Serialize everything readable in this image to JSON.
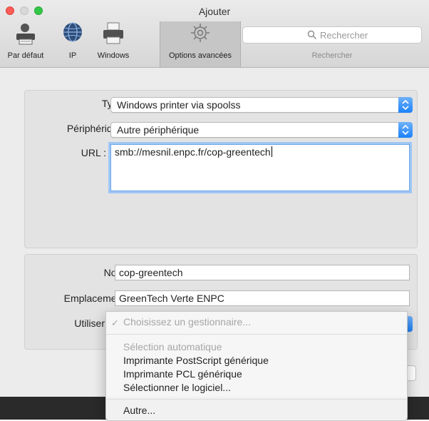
{
  "window": {
    "title": "Ajouter"
  },
  "toolbar": {
    "items": [
      {
        "label": "Par défaut",
        "icon": "default-printer-icon"
      },
      {
        "label": "IP",
        "icon": "globe-icon"
      },
      {
        "label": "Windows",
        "icon": "printer-icon"
      },
      {
        "label": "Options avancées",
        "icon": "gear-icon"
      }
    ],
    "search": {
      "placeholder": "Rechercher",
      "label": "Rechercher"
    }
  },
  "form": {
    "type": {
      "label": "Type :",
      "value": "Windows printer via spoolss"
    },
    "device": {
      "label": "Périphérique :",
      "value": "Autre périphérique"
    },
    "url": {
      "label": "URL :",
      "value": "smb://mesnil.enpc.fr/cop-greentech"
    },
    "name": {
      "label": "Nom :",
      "value": "cop-greentech"
    },
    "location": {
      "label": "Emplacement :",
      "value": "GreenTech Verte ENPC"
    },
    "use": {
      "label": "Utiliser",
      "value": "Choisissez un gestionnaire..."
    }
  },
  "menu": {
    "checked_item": "Choisissez un gestionnaire...",
    "disabled_item": "Sélection automatique",
    "items": [
      "Imprimante PostScript générique",
      "Imprimante PCL générique",
      "Sélectionner le logiciel..."
    ],
    "other": "Autre..."
  },
  "colors": {
    "accent": "#1a82fb",
    "close": "#fc5b57",
    "maximize": "#33c748"
  }
}
